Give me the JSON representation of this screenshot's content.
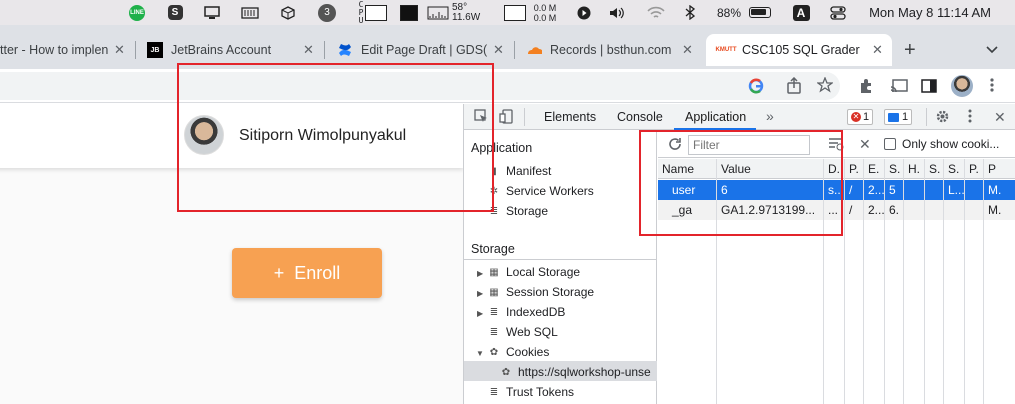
{
  "menubar": {
    "clock": "Mon May 8  11:14 AM",
    "battery": "88%",
    "input_source": "A",
    "cpu_temp": "58°",
    "power": "11.6W",
    "net_up": "0.0 M",
    "net_down": "0.0 M",
    "notif_count": "3",
    "line_label": "LINE",
    "s_label": "S"
  },
  "tabs": [
    {
      "title": "tter - How to implen",
      "favicon": ""
    },
    {
      "title": "JetBrains Account",
      "favicon": "JB"
    },
    {
      "title": "Edit Page Draft | GDS(",
      "favicon": ""
    },
    {
      "title": "Records | bsthun.com",
      "favicon": ""
    },
    {
      "title": "CSC105 SQL Grader",
      "favicon": "KMUTT"
    }
  ],
  "page": {
    "username": "Sitiporn Wimolpunyakul",
    "enroll_label": "Enroll",
    "enroll_plus": "+"
  },
  "devtools": {
    "tabs": [
      "Elements",
      "Console",
      "Application"
    ],
    "more": "»",
    "error_count": "1",
    "message_count": "1",
    "app_section": "Application",
    "app_items": [
      "Manifest",
      "Service Workers",
      "Storage"
    ],
    "storage_section": "Storage",
    "storage_items": [
      "Local Storage",
      "Session Storage",
      "IndexedDB",
      "Web SQL",
      "Cookies"
    ],
    "cookie_origin": "https://sqlworkshop-unse",
    "trust_tokens": "Trust Tokens",
    "filter_placeholder": "Filter",
    "only_show_cookies": "Only show cooki...",
    "columns": [
      "Name",
      "Value",
      "D.",
      "P.",
      "E.",
      "S.",
      "H.",
      "S.",
      "S.",
      "P.",
      "P"
    ],
    "rows": [
      [
        "user",
        "6",
        "s..",
        "/",
        "2...",
        "5",
        "",
        "",
        "L...",
        "",
        "M."
      ],
      [
        "_ga",
        "GA1.2.9713199...",
        "...",
        "/",
        "2...",
        "6.",
        "",
        "",
        "",
        "",
        "M."
      ]
    ]
  },
  "colors": {
    "accent": "#1a73e8",
    "enroll": "#f7a152",
    "annotation": "#e3242b"
  }
}
